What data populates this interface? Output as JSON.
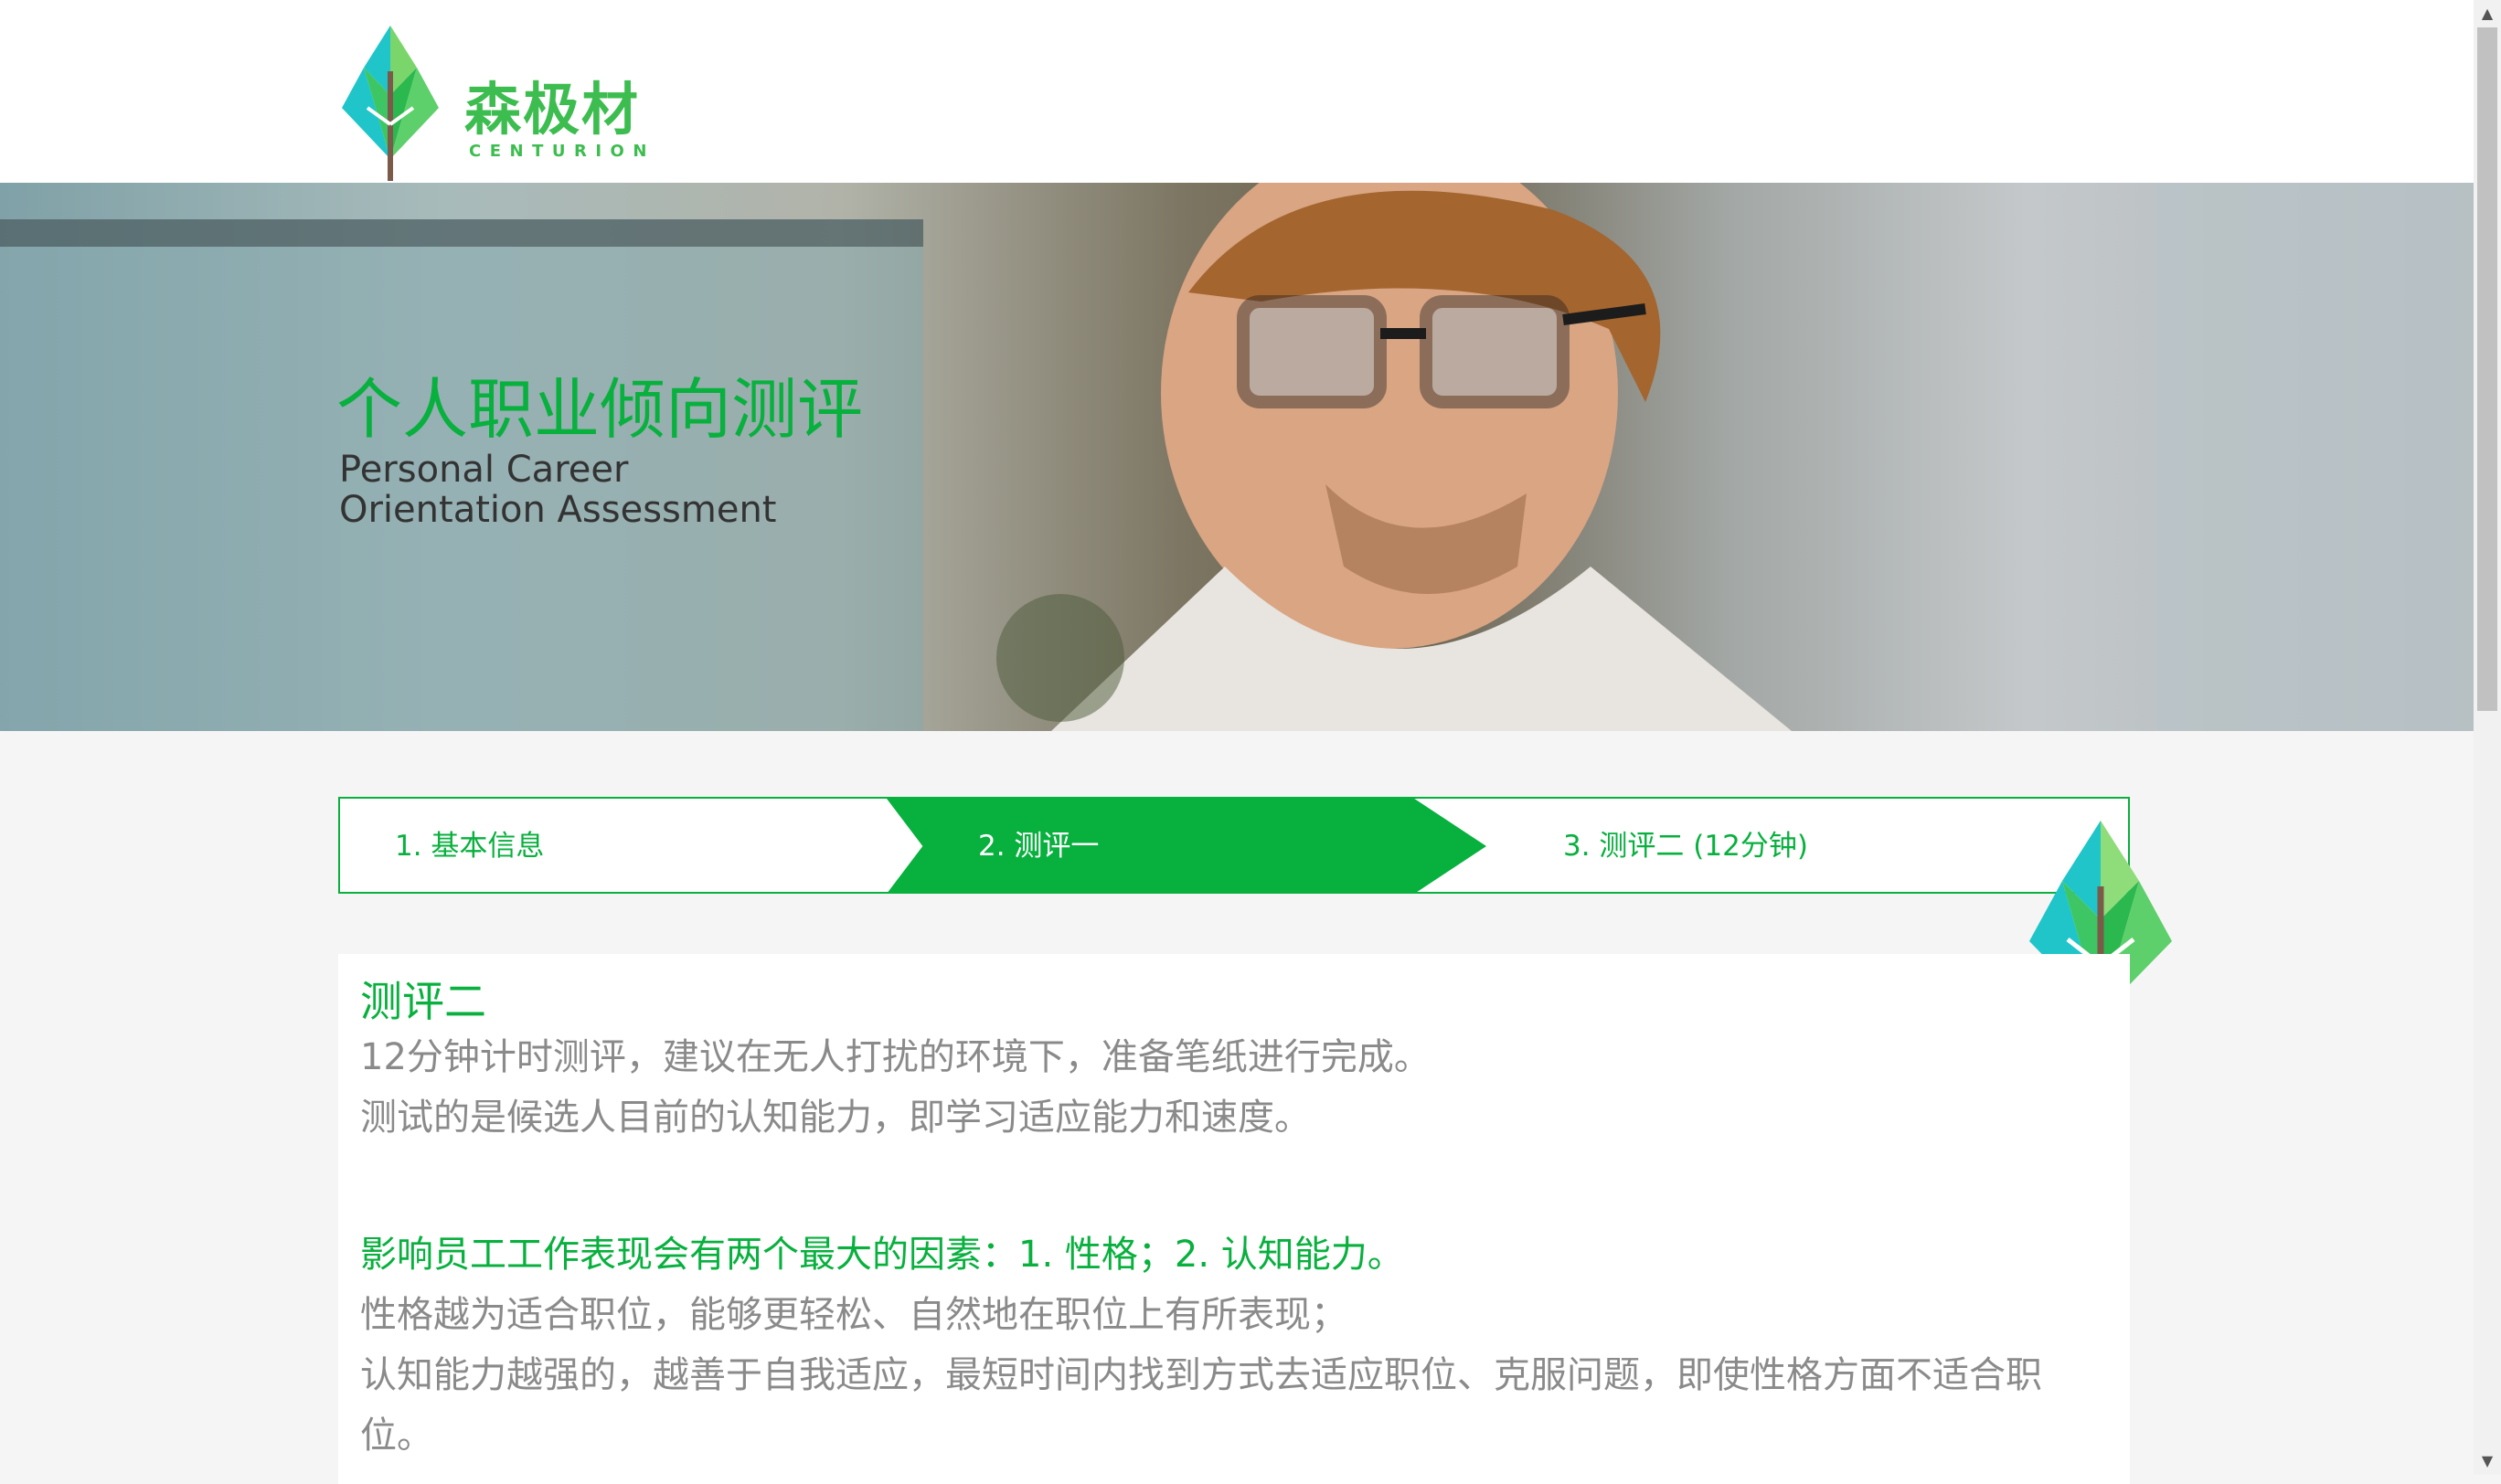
{
  "brand": {
    "name_cn": "森极材",
    "name_en": "CENTURION"
  },
  "hero": {
    "title": "个人职业倾向测评",
    "subtitle_line1": "Personal Career",
    "subtitle_line2": "Orientation Assessment"
  },
  "steps": [
    {
      "label": "1. 基本信息",
      "state": "inactive"
    },
    {
      "label": "2. 测评一",
      "state": "active"
    },
    {
      "label": "3. 测评二 (12分钟)",
      "state": "inactive"
    }
  ],
  "content": {
    "title": "测评二",
    "line1": "12分钟计时测评，建议在无人打扰的环境下，准备笔纸进行完成。",
    "line2": "测试的是候选人目前的认知能力，即学习适应能力和速度。",
    "highlight": "影响员工工作表现会有两个最大的因素：1. 性格；2. 认知能力。",
    "line3": "性格越为适合职位，能够更轻松、自然地在职位上有所表现；",
    "line4": "认知能力越强的，越善于自我适应，最短时间内找到方式去适应职位、克服问题，即使性格方面不适合职位。"
  },
  "colors": {
    "brand_green": "#08b03e",
    "logo_green": "#3dbd4f",
    "body_text": "#8a8a8a"
  },
  "icons": {
    "logo": "tree-logo-icon",
    "decoration": "tree-decoration-icon",
    "scroll_up": "▲",
    "scroll_down": "▼"
  }
}
